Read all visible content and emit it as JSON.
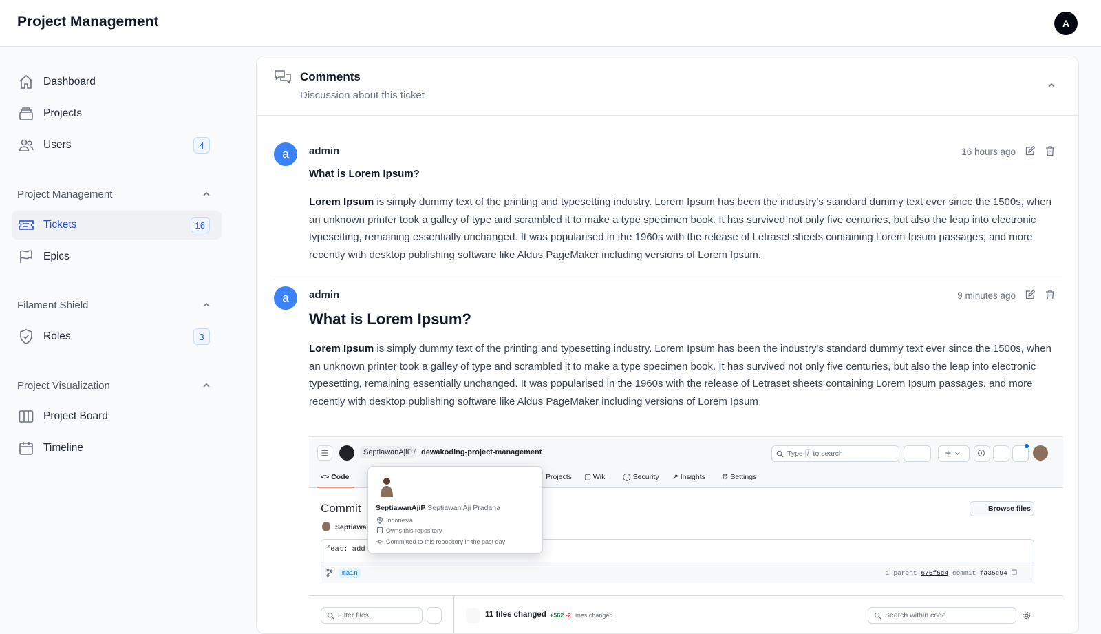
{
  "header": {
    "title": "Project Management",
    "avatar_initial": "A"
  },
  "sidebar": {
    "items": [
      {
        "label": "Dashboard",
        "icon": "home-icon"
      },
      {
        "label": "Projects",
        "icon": "stack-icon"
      },
      {
        "label": "Users",
        "icon": "users-icon",
        "badge": "4"
      }
    ],
    "groups": [
      {
        "label": "Project Management",
        "items": [
          {
            "label": "Tickets",
            "icon": "ticket-icon",
            "badge": "16",
            "active": true
          },
          {
            "label": "Epics",
            "icon": "flag-icon"
          }
        ]
      },
      {
        "label": "Filament Shield",
        "items": [
          {
            "label": "Roles",
            "icon": "shield-icon",
            "badge": "3"
          }
        ]
      },
      {
        "label": "Project Visualization",
        "items": [
          {
            "label": "Project Board",
            "icon": "columns-icon"
          },
          {
            "label": "Timeline",
            "icon": "calendar-icon"
          }
        ]
      }
    ]
  },
  "comments_section": {
    "title": "Comments",
    "subtitle": "Discussion about this ticket",
    "comments": [
      {
        "avatar": "a",
        "user": "admin",
        "time": "16 hours ago",
        "heading": "What is Lorem Ipsum?",
        "lead": "Lorem Ipsum",
        "body": " is simply dummy text of the printing and typesetting industry. Lorem Ipsum has been the industry's standard dummy text ever since the 1500s, when an unknown printer took a galley of type and scrambled it to make a type specimen book. It has survived not only five centuries, but also the leap into electronic typesetting, remaining essentially unchanged. It was popularised in the 1960s with the release of Letraset sheets containing Lorem Ipsum passages, and more recently with desktop publishing software like Aldus PageMaker including versions of Lorem Ipsum."
      },
      {
        "avatar": "a",
        "user": "admin",
        "time": "9 minutes ago",
        "heading": "What is Lorem Ipsum?",
        "lead": "Lorem Ipsum",
        "body": " is simply dummy text of the printing and typesetting industry. Lorem Ipsum has been the industry's standard dummy text ever since the 1500s, when an unknown printer took a galley of type and scrambled it to make a type specimen book. It has survived not only five centuries, but also the leap into electronic typesetting, remaining essentially unchanged. It was popularised in the 1960s with the release of Letraset sheets containing Lorem Ipsum passages, and more recently with desktop publishing software like Aldus PageMaker including versions of Lorem Ipsum",
        "screenshot": {
          "owner": "SeptiawanAjiP",
          "repo": "dewakoding-project-management",
          "search_type": "Type",
          "search_key": "/",
          "search_rest": "to search",
          "tabs": [
            "Code",
            "Projects",
            "Wiki",
            "Security",
            "Insights",
            "Settings"
          ],
          "commit_title": "Commit",
          "author": "Septiawan",
          "browse_files": "Browse files",
          "commit_message": "feat: add",
          "branch": "main",
          "parent_prefix": "1 parent",
          "parent_sha": "676f5c4",
          "commit_prefix": "commit",
          "commit_sha": "fa35c94",
          "filter_placeholder": "Filter files...",
          "files_changed": "11 files changed",
          "additions": "+562",
          "deletions": "-2",
          "lines_changed": "lines changed",
          "code_search_placeholder": "Search within code",
          "popover": {
            "username": "SeptiawanAjiP",
            "fullname": "Septiawan Aji Pradana",
            "location": "Indonesia",
            "owns": "Owns this repository",
            "committed": "Committed to this repository in the past day"
          }
        }
      }
    ]
  }
}
